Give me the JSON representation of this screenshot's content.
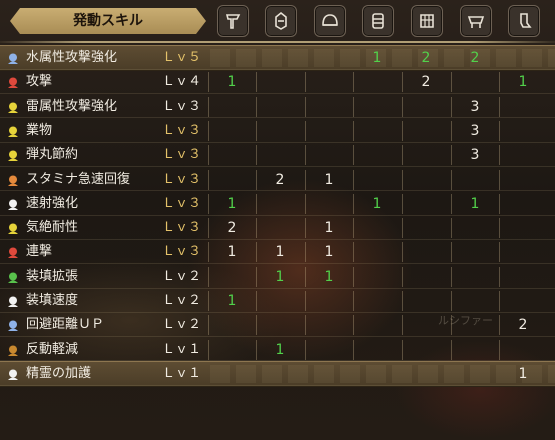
{
  "header": {
    "title": "発動スキル",
    "columns": [
      {
        "icon": "weapon-icon"
      },
      {
        "icon": "charm-icon"
      },
      {
        "icon": "helm-icon"
      },
      {
        "icon": "chest-armor-icon"
      },
      {
        "icon": "arm-armor-icon"
      },
      {
        "icon": "waist-armor-icon"
      },
      {
        "icon": "leg-armor-icon"
      }
    ]
  },
  "watermark": "ルシファー",
  "colors": {
    "green_value": "#52d14b",
    "level_yellow": "#e4c26a",
    "header_gold": "#c9ad72"
  },
  "skills": [
    {
      "label": "水属性攻撃強化",
      "level": "Ｌｖ５",
      "icon_color": "#8fb2e8",
      "level_style": "yellow",
      "highlight": true,
      "cells": [
        "",
        "",
        "",
        "1",
        "2",
        "2",
        ""
      ],
      "green": [
        false,
        false,
        false,
        true,
        true,
        true,
        false
      ]
    },
    {
      "label": "攻撃",
      "level": "Ｌｖ４",
      "icon_color": "#e0493c",
      "level_style": "white",
      "highlight": false,
      "cells": [
        "1",
        "",
        "",
        "",
        "2",
        "",
        "1"
      ],
      "green": [
        true,
        false,
        false,
        false,
        false,
        false,
        true
      ]
    },
    {
      "label": "雷属性攻撃強化",
      "level": "Ｌｖ３",
      "icon_color": "#e6d33a",
      "level_style": "white",
      "highlight": false,
      "cells": [
        "",
        "",
        "",
        "",
        "",
        "3",
        ""
      ],
      "green": [
        false,
        false,
        false,
        false,
        false,
        false,
        false
      ]
    },
    {
      "label": "業物",
      "level": "Ｌｖ３",
      "icon_color": "#e6d33a",
      "level_style": "yellow",
      "highlight": false,
      "cells": [
        "",
        "",
        "",
        "",
        "",
        "3",
        ""
      ],
      "green": [
        false,
        false,
        false,
        false,
        false,
        false,
        false
      ]
    },
    {
      "label": "弾丸節約",
      "level": "Ｌｖ３",
      "icon_color": "#e6d33a",
      "level_style": "yellow",
      "highlight": false,
      "cells": [
        "",
        "",
        "",
        "",
        "",
        "3",
        ""
      ],
      "green": [
        false,
        false,
        false,
        false,
        false,
        false,
        false
      ]
    },
    {
      "label": "スタミナ急速回復",
      "level": "Ｌｖ３",
      "icon_color": "#e58a3c",
      "level_style": "yellow",
      "highlight": false,
      "cells": [
        "",
        "2",
        "1",
        "",
        "",
        "",
        ""
      ],
      "green": [
        false,
        false,
        false,
        false,
        false,
        false,
        false
      ]
    },
    {
      "label": "速射強化",
      "level": "Ｌｖ３",
      "icon_color": "#f2f2f2",
      "level_style": "yellow",
      "highlight": false,
      "cells": [
        "1",
        "",
        "",
        "1",
        "",
        "1",
        ""
      ],
      "green": [
        true,
        false,
        false,
        true,
        false,
        true,
        false
      ]
    },
    {
      "label": "気絶耐性",
      "level": "Ｌｖ３",
      "icon_color": "#e6d33a",
      "level_style": "yellow",
      "highlight": false,
      "cells": [
        "2",
        "",
        "1",
        "",
        "",
        "",
        ""
      ],
      "green": [
        false,
        false,
        false,
        false,
        false,
        false,
        false
      ]
    },
    {
      "label": "連撃",
      "level": "Ｌｖ３",
      "icon_color": "#e0493c",
      "level_style": "yellow",
      "highlight": false,
      "cells": [
        "1",
        "1",
        "1",
        "",
        "",
        "",
        ""
      ],
      "green": [
        false,
        false,
        false,
        false,
        false,
        false,
        false
      ]
    },
    {
      "label": "装填拡張",
      "level": "Ｌｖ２",
      "icon_color": "#59c24c",
      "level_style": "white",
      "highlight": false,
      "cells": [
        "",
        "1",
        "1",
        "",
        "",
        "",
        ""
      ],
      "green": [
        false,
        true,
        true,
        false,
        false,
        false,
        false
      ]
    },
    {
      "label": "装填速度",
      "level": "Ｌｖ２",
      "icon_color": "#f2f2f2",
      "level_style": "white",
      "highlight": false,
      "cells": [
        "1",
        "",
        "",
        "",
        "",
        "",
        ""
      ],
      "green": [
        true,
        false,
        false,
        false,
        false,
        false,
        false
      ]
    },
    {
      "label": "回避距離ＵＰ",
      "level": "Ｌｖ２",
      "icon_color": "#8fb2e8",
      "level_style": "white",
      "highlight": false,
      "cells": [
        "",
        "",
        "",
        "",
        "",
        "",
        "2"
      ],
      "green": [
        false,
        false,
        false,
        false,
        false,
        false,
        false
      ]
    },
    {
      "label": "反動軽減",
      "level": "Ｌｖ１",
      "icon_color": "#c9892f",
      "level_style": "white",
      "highlight": false,
      "cells": [
        "",
        "1",
        "",
        "",
        "",
        "",
        ""
      ],
      "green": [
        false,
        true,
        false,
        false,
        false,
        false,
        false
      ]
    },
    {
      "label": "精霊の加護",
      "level": "Ｌｖ１",
      "icon_color": "#f2f2f2",
      "level_style": "white",
      "highlight": true,
      "cells": [
        "",
        "",
        "",
        "",
        "",
        "",
        "1"
      ],
      "green": [
        false,
        false,
        false,
        false,
        false,
        false,
        false
      ]
    }
  ]
}
